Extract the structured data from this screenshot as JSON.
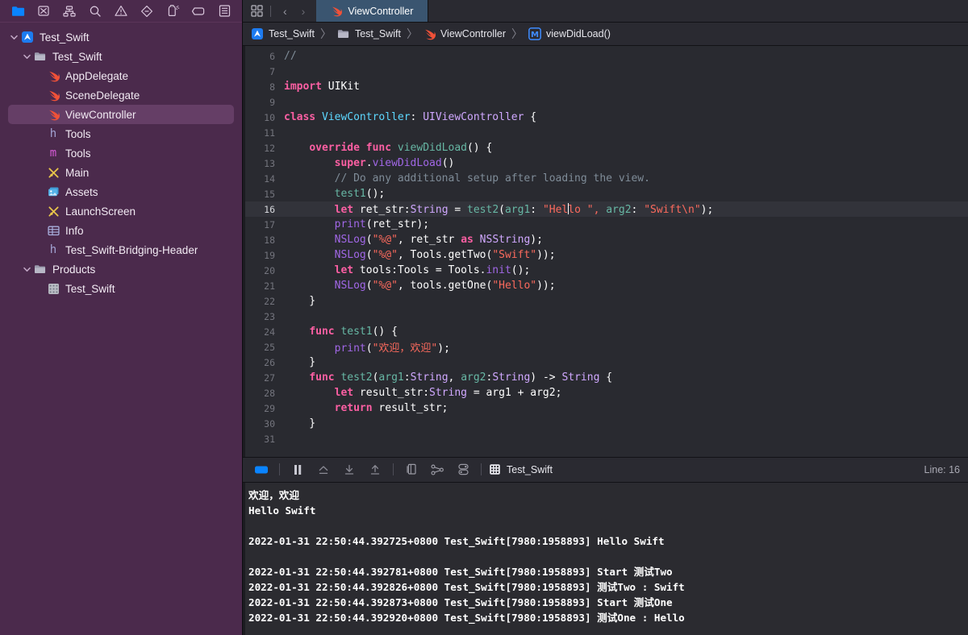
{
  "sidebar": {
    "toolbar_icons": [
      {
        "name": "folder-icon",
        "label": "Project navigator"
      },
      {
        "name": "source-control-icon",
        "label": "Source control navigator"
      },
      {
        "name": "hierarchy-icon",
        "label": "Symbol navigator"
      },
      {
        "name": "search-icon",
        "label": "Find navigator"
      },
      {
        "name": "warning-icon",
        "label": "Issue navigator"
      },
      {
        "name": "test-diamond-icon",
        "label": "Test navigator"
      },
      {
        "name": "debug-gauge-icon",
        "label": "Debug navigator"
      },
      {
        "name": "breakpoint-icon",
        "label": "Breakpoint navigator"
      },
      {
        "name": "report-icon",
        "label": "Report navigator"
      }
    ],
    "items": [
      {
        "label": "Test_Swift",
        "icon": "xcode-project-icon",
        "indent": 0,
        "twisty": "down",
        "selected": false
      },
      {
        "label": "Test_Swift",
        "icon": "folder-icon",
        "indent": 1,
        "twisty": "down",
        "selected": false
      },
      {
        "label": "AppDelegate",
        "icon": "swift-icon",
        "indent": 2,
        "twisty": "none",
        "selected": false
      },
      {
        "label": "SceneDelegate",
        "icon": "swift-icon",
        "indent": 2,
        "twisty": "none",
        "selected": false
      },
      {
        "label": "ViewController",
        "icon": "swift-icon",
        "indent": 2,
        "twisty": "none",
        "selected": true
      },
      {
        "label": "Tools",
        "icon": "header-h-icon",
        "indent": 2,
        "twisty": "none",
        "selected": false
      },
      {
        "label": "Tools",
        "icon": "objc-m-icon",
        "indent": 2,
        "twisty": "none",
        "selected": false
      },
      {
        "label": "Main",
        "icon": "storyboard-icon",
        "indent": 2,
        "twisty": "none",
        "selected": false
      },
      {
        "label": "Assets",
        "icon": "assets-icon",
        "indent": 2,
        "twisty": "none",
        "selected": false
      },
      {
        "label": "LaunchScreen",
        "icon": "storyboard-icon",
        "indent": 2,
        "twisty": "none",
        "selected": false
      },
      {
        "label": "Info",
        "icon": "plist-icon",
        "indent": 2,
        "twisty": "none",
        "selected": false
      },
      {
        "label": "Test_Swift-Bridging-Header",
        "icon": "header-h-icon",
        "indent": 2,
        "twisty": "none",
        "selected": false
      },
      {
        "label": "Products",
        "icon": "folder-icon",
        "indent": 1,
        "twisty": "down",
        "selected": false
      },
      {
        "label": "Test_Swift",
        "icon": "app-binary-icon",
        "indent": 2,
        "twisty": "none",
        "selected": false
      }
    ]
  },
  "tabbar": {
    "grid_icon": "editor-options-icon",
    "back_arrow": "‹",
    "forward_arrow": "›",
    "active_tab": {
      "label": "ViewController",
      "icon": "swift-icon"
    }
  },
  "breadcrumbs": [
    {
      "label": "Test_Swift",
      "icon": "xcode-project-icon"
    },
    {
      "label": "Test_Swift",
      "icon": "folder-icon"
    },
    {
      "label": "ViewController",
      "icon": "swift-icon"
    },
    {
      "label": "viewDidLoad()",
      "icon": "method-m-icon"
    }
  ],
  "editor": {
    "lines": [
      {
        "n": "6",
        "hl": false,
        "tokens": [
          {
            "t": "//",
            "c": "cmt"
          }
        ]
      },
      {
        "n": "7",
        "hl": false,
        "tokens": []
      },
      {
        "n": "8",
        "hl": false,
        "tokens": [
          {
            "t": "import",
            "c": "kw"
          },
          {
            "t": " UIKit",
            "c": "plain"
          }
        ]
      },
      {
        "n": "9",
        "hl": false,
        "tokens": []
      },
      {
        "n": "10",
        "hl": false,
        "tokens": [
          {
            "t": "class",
            "c": "kw"
          },
          {
            "t": " ",
            "c": "plain"
          },
          {
            "t": "ViewController",
            "c": "cls"
          },
          {
            "t": ": ",
            "c": "plain"
          },
          {
            "t": "UIViewController",
            "c": "typ2"
          },
          {
            "t": " {",
            "c": "plain"
          }
        ]
      },
      {
        "n": "11",
        "hl": false,
        "tokens": []
      },
      {
        "n": "12",
        "hl": false,
        "tokens": [
          {
            "t": "    ",
            "c": "plain"
          },
          {
            "t": "override func",
            "c": "kw"
          },
          {
            "t": " ",
            "c": "plain"
          },
          {
            "t": "viewDidLoad",
            "c": "fn"
          },
          {
            "t": "() {",
            "c": "plain"
          }
        ]
      },
      {
        "n": "13",
        "hl": false,
        "tokens": [
          {
            "t": "        ",
            "c": "plain"
          },
          {
            "t": "super",
            "c": "kw"
          },
          {
            "t": ".",
            "c": "plain"
          },
          {
            "t": "viewDidLoad",
            "c": "meth"
          },
          {
            "t": "()",
            "c": "plain"
          }
        ]
      },
      {
        "n": "14",
        "hl": false,
        "tokens": [
          {
            "t": "        ",
            "c": "plain"
          },
          {
            "t": "// Do any additional setup after loading the view.",
            "c": "cmt"
          }
        ]
      },
      {
        "n": "15",
        "hl": false,
        "tokens": [
          {
            "t": "        ",
            "c": "plain"
          },
          {
            "t": "test1",
            "c": "fn"
          },
          {
            "t": "();",
            "c": "plain"
          }
        ]
      },
      {
        "n": "16",
        "hl": true,
        "tokens": [
          {
            "t": "        ",
            "c": "plain"
          },
          {
            "t": "let",
            "c": "kw"
          },
          {
            "t": " ret_str:",
            "c": "plain"
          },
          {
            "t": "String",
            "c": "typ2"
          },
          {
            "t": " = ",
            "c": "plain"
          },
          {
            "t": "test2",
            "c": "fn"
          },
          {
            "t": "(",
            "c": "plain"
          },
          {
            "t": "arg1",
            "c": "fn"
          },
          {
            "t": ": ",
            "c": "plain"
          },
          {
            "t": "\"Hel",
            "c": "str"
          },
          {
            "t": "__CURSOR__",
            "c": "cursor"
          },
          {
            "t": "lo \", ",
            "c": "str"
          },
          {
            "t": "arg2",
            "c": "fn"
          },
          {
            "t": ": ",
            "c": "plain"
          },
          {
            "t": "\"Swift\\n\"",
            "c": "str"
          },
          {
            "t": ");",
            "c": "plain"
          }
        ]
      },
      {
        "n": "17",
        "hl": false,
        "tokens": [
          {
            "t": "        ",
            "c": "plain"
          },
          {
            "t": "print",
            "c": "meth"
          },
          {
            "t": "(ret_str);",
            "c": "plain"
          }
        ]
      },
      {
        "n": "18",
        "hl": false,
        "tokens": [
          {
            "t": "        ",
            "c": "plain"
          },
          {
            "t": "NSLog",
            "c": "meth"
          },
          {
            "t": "(",
            "c": "plain"
          },
          {
            "t": "\"%@\"",
            "c": "str"
          },
          {
            "t": ", ret_str ",
            "c": "plain"
          },
          {
            "t": "as",
            "c": "kw"
          },
          {
            "t": " ",
            "c": "plain"
          },
          {
            "t": "NSString",
            "c": "typ2"
          },
          {
            "t": ");",
            "c": "plain"
          }
        ]
      },
      {
        "n": "19",
        "hl": false,
        "tokens": [
          {
            "t": "        ",
            "c": "plain"
          },
          {
            "t": "NSLog",
            "c": "meth"
          },
          {
            "t": "(",
            "c": "plain"
          },
          {
            "t": "\"%@\"",
            "c": "str"
          },
          {
            "t": ", Tools.getTwo(",
            "c": "plain"
          },
          {
            "t": "\"Swift\"",
            "c": "str"
          },
          {
            "t": "));",
            "c": "plain"
          }
        ]
      },
      {
        "n": "20",
        "hl": false,
        "tokens": [
          {
            "t": "        ",
            "c": "plain"
          },
          {
            "t": "let",
            "c": "kw"
          },
          {
            "t": " tools:Tools = Tools.",
            "c": "plain"
          },
          {
            "t": "init",
            "c": "meth"
          },
          {
            "t": "();",
            "c": "plain"
          }
        ]
      },
      {
        "n": "21",
        "hl": false,
        "tokens": [
          {
            "t": "        ",
            "c": "plain"
          },
          {
            "t": "NSLog",
            "c": "meth"
          },
          {
            "t": "(",
            "c": "plain"
          },
          {
            "t": "\"%@\"",
            "c": "str"
          },
          {
            "t": ", tools.getOne(",
            "c": "plain"
          },
          {
            "t": "\"Hello\"",
            "c": "str"
          },
          {
            "t": "));",
            "c": "plain"
          }
        ]
      },
      {
        "n": "22",
        "hl": false,
        "tokens": [
          {
            "t": "    }",
            "c": "plain"
          }
        ]
      },
      {
        "n": "23",
        "hl": false,
        "tokens": []
      },
      {
        "n": "24",
        "hl": false,
        "tokens": [
          {
            "t": "    ",
            "c": "plain"
          },
          {
            "t": "func",
            "c": "kw"
          },
          {
            "t": " ",
            "c": "plain"
          },
          {
            "t": "test1",
            "c": "fn"
          },
          {
            "t": "() {",
            "c": "plain"
          }
        ]
      },
      {
        "n": "25",
        "hl": false,
        "tokens": [
          {
            "t": "        ",
            "c": "plain"
          },
          {
            "t": "print",
            "c": "meth"
          },
          {
            "t": "(",
            "c": "plain"
          },
          {
            "t": "\"欢迎，欢迎\"",
            "c": "str"
          },
          {
            "t": ");",
            "c": "plain"
          }
        ]
      },
      {
        "n": "26",
        "hl": false,
        "tokens": [
          {
            "t": "    }",
            "c": "plain"
          }
        ]
      },
      {
        "n": "27",
        "hl": false,
        "tokens": [
          {
            "t": "    ",
            "c": "plain"
          },
          {
            "t": "func",
            "c": "kw"
          },
          {
            "t": " ",
            "c": "plain"
          },
          {
            "t": "test2",
            "c": "fn"
          },
          {
            "t": "(",
            "c": "plain"
          },
          {
            "t": "arg1",
            "c": "fn"
          },
          {
            "t": ":",
            "c": "plain"
          },
          {
            "t": "String",
            "c": "typ2"
          },
          {
            "t": ", ",
            "c": "plain"
          },
          {
            "t": "arg2",
            "c": "fn"
          },
          {
            "t": ":",
            "c": "plain"
          },
          {
            "t": "String",
            "c": "typ2"
          },
          {
            "t": ") -> ",
            "c": "plain"
          },
          {
            "t": "String",
            "c": "typ2"
          },
          {
            "t": " {",
            "c": "plain"
          }
        ]
      },
      {
        "n": "28",
        "hl": false,
        "tokens": [
          {
            "t": "        ",
            "c": "plain"
          },
          {
            "t": "let",
            "c": "kw"
          },
          {
            "t": " result_str:",
            "c": "plain"
          },
          {
            "t": "String",
            "c": "typ2"
          },
          {
            "t": " = arg1 + arg2;",
            "c": "plain"
          }
        ]
      },
      {
        "n": "29",
        "hl": false,
        "tokens": [
          {
            "t": "        ",
            "c": "plain"
          },
          {
            "t": "return",
            "c": "kw"
          },
          {
            "t": " result_str;",
            "c": "plain"
          }
        ]
      },
      {
        "n": "30",
        "hl": false,
        "tokens": [
          {
            "t": "    }",
            "c": "plain"
          }
        ]
      },
      {
        "n": "31",
        "hl": false,
        "tokens": []
      }
    ]
  },
  "debugbar": {
    "buttons": [
      {
        "name": "toggle-console-icon",
        "label": "Hide/show debug area"
      },
      {
        "name": "pause-icon",
        "label": "Pause program execution"
      },
      {
        "name": "step-over-icon",
        "label": "Step over"
      },
      {
        "name": "step-into-icon",
        "label": "Step into"
      },
      {
        "name": "step-out-icon",
        "label": "Step out"
      },
      {
        "name": "view-hierarchy-icon",
        "label": "Debug View Hierarchy"
      },
      {
        "name": "memory-graph-icon",
        "label": "Debug Memory Graph"
      },
      {
        "name": "environment-overrides-icon",
        "label": "Environment Overrides"
      }
    ],
    "scheme": {
      "label": "Test_Swift",
      "icon": "process-icon"
    },
    "line_status": "Line: 16"
  },
  "console": {
    "lines": [
      "欢迎，欢迎",
      "Hello Swift",
      "",
      "2022-01-31 22:50:44.392725+0800 Test_Swift[7980:1958893] Hello Swift",
      "",
      "2022-01-31 22:50:44.392781+0800 Test_Swift[7980:1958893] Start 测试Two",
      "2022-01-31 22:50:44.392826+0800 Test_Swift[7980:1958893] 测试Two : Swift",
      "2022-01-31 22:50:44.392873+0800 Test_Swift[7980:1958893] Start 测试One",
      "2022-01-31 22:50:44.392920+0800 Test_Swift[7980:1958893] 测试One : Hello"
    ]
  },
  "colors": {
    "sidebar_bg": "#4b2a4c",
    "sidebar_selected": "#653e66",
    "editor_bg": "#292a30",
    "console_bg": "#2b2b30",
    "tab_active": "#3a5570",
    "chrome_bg": "#2a2a31",
    "swift_orange": "#f05138",
    "accent_blue": "#0a84ff",
    "string_red": "#fc6a5d",
    "keyword_pink": "#fc5fa3"
  }
}
